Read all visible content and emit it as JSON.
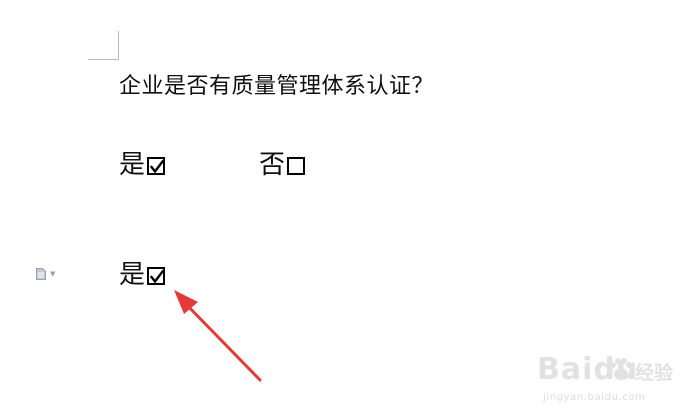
{
  "document": {
    "question": "企业是否有质量管理体系认证？",
    "options_row_1": [
      {
        "label": "是",
        "checked": true
      },
      {
        "label": "否",
        "checked": false
      }
    ],
    "option_row_2": {
      "label": "是",
      "checked": true
    }
  },
  "annotation": {
    "arrow_color": "#e53935",
    "arrow_target": "checked-checkbox"
  },
  "watermark": {
    "brand": "Baidu",
    "brand_cn": "经验",
    "url": "jingyan.baidu.com"
  },
  "icons": {
    "paragraph_icon": "document-icon",
    "paragraph_dropdown": "caret-down-icon"
  }
}
